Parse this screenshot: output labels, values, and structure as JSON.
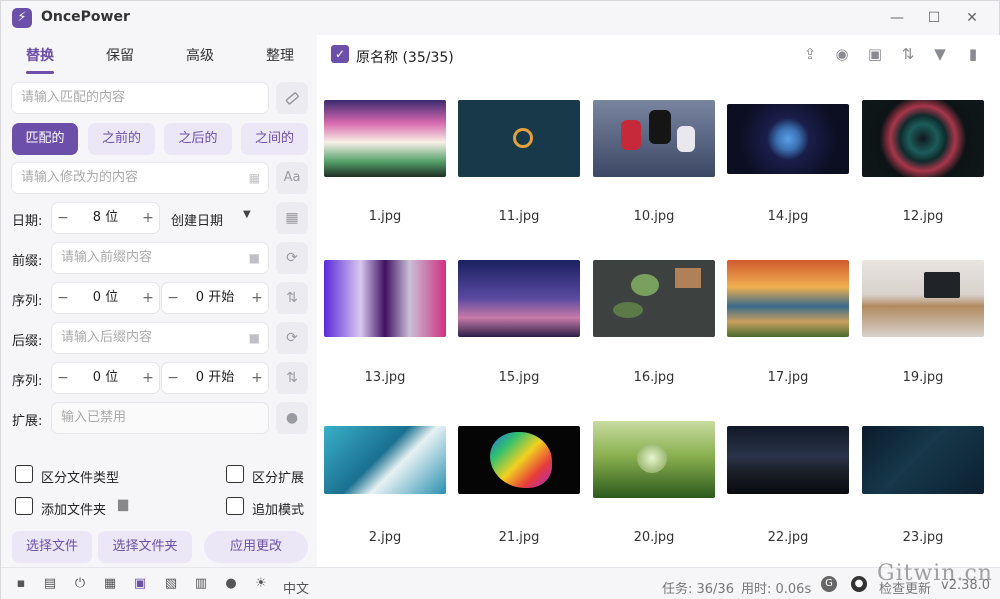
{
  "app": {
    "title": "OncePower",
    "logo_glyph": "⚡"
  },
  "window_controls": {
    "minimize": "—",
    "maximize": "☐",
    "close": "✕"
  },
  "tabs": [
    {
      "label": "替换",
      "active": true
    },
    {
      "label": "保留",
      "active": false
    },
    {
      "label": "高级",
      "active": false
    },
    {
      "label": "整理",
      "active": false
    }
  ],
  "match": {
    "placeholder": "请输入匹配的内容"
  },
  "mode_buttons": [
    {
      "label": "匹配的",
      "active": true
    },
    {
      "label": "之前的",
      "active": false
    },
    {
      "label": "之后的",
      "active": false
    },
    {
      "label": "之间的",
      "active": false
    }
  ],
  "replace": {
    "placeholder": "请输入修改为的内容"
  },
  "date": {
    "label": "日期:",
    "digits": "8 位",
    "type": "创建日期"
  },
  "prefix": {
    "label": "前缀:",
    "placeholder": "请输入前缀内容"
  },
  "sequence1": {
    "label": "序列:",
    "digits": "0 位",
    "start": "0 开始"
  },
  "suffix": {
    "label": "后缀:",
    "placeholder": "请输入后缀内容"
  },
  "sequence2": {
    "label": "序列:",
    "digits": "0 位",
    "start": "0 开始"
  },
  "extension": {
    "label": "扩展:",
    "placeholder": "输入已禁用"
  },
  "options": {
    "distinguish_type": "区分文件类型",
    "distinguish_ext": "区分扩展",
    "add_folder": "添加文件夹",
    "append_mode": "追加模式"
  },
  "buttons": {
    "select_file": "选择文件",
    "select_folder": "选择文件夹",
    "apply": "应用更改"
  },
  "file_list": {
    "original_name_label": "原名称 (35/35)",
    "original_name_checked": true,
    "files": [
      {
        "name": "1.jpg"
      },
      {
        "name": "11.jpg"
      },
      {
        "name": "10.jpg"
      },
      {
        "name": "14.jpg"
      },
      {
        "name": "12.jpg"
      },
      {
        "name": "13.jpg"
      },
      {
        "name": "15.jpg"
      },
      {
        "name": "16.jpg"
      },
      {
        "name": "17.jpg"
      },
      {
        "name": "19.jpg"
      },
      {
        "name": "2.jpg"
      },
      {
        "name": "21.jpg"
      },
      {
        "name": "20.jpg"
      },
      {
        "name": "22.jpg"
      },
      {
        "name": "23.jpg"
      }
    ]
  },
  "status": {
    "language": "中文",
    "tasks": "任务: 36/36",
    "time": "用时: 0.06s",
    "update": "检查更新",
    "version": "v2.38.0",
    "watermark": "Gitwin.cn"
  },
  "colors": {
    "accent": "#6b4fa8",
    "accent_light": "#ece7f6"
  }
}
